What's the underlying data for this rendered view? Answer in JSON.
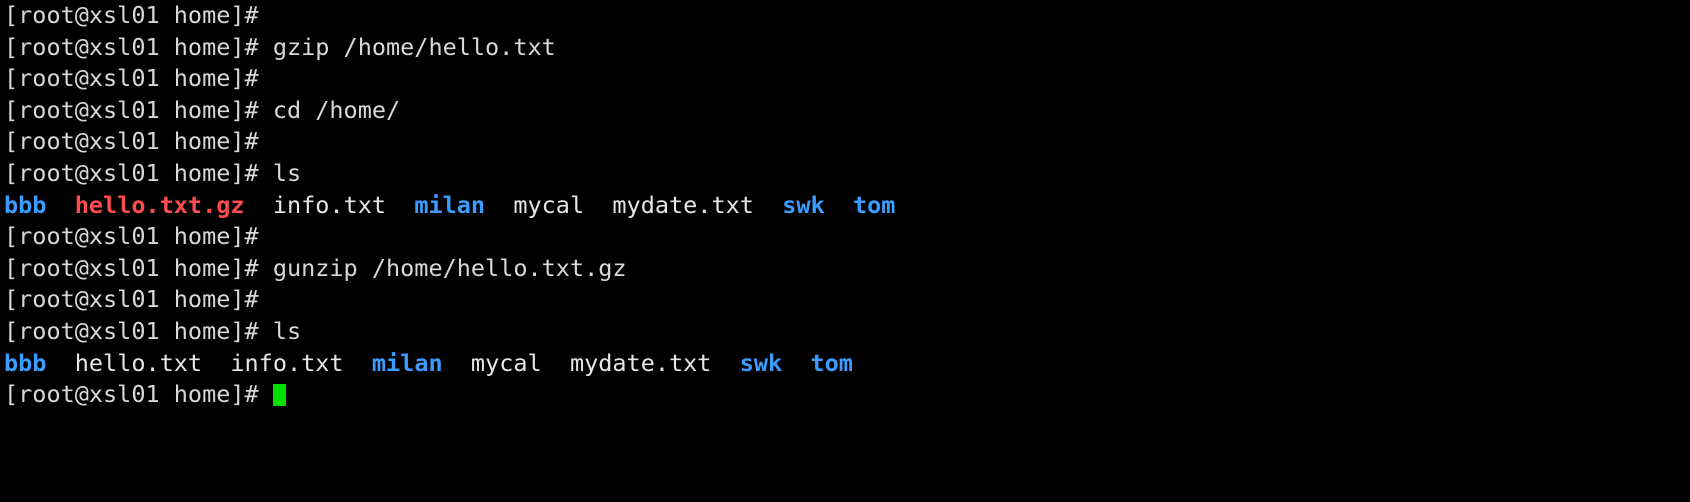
{
  "terminal": {
    "background_color": "#000000",
    "foreground_color": "#d8d8d8",
    "cursor_color": "#00e000",
    "prompt": "[root@xsl01 home]# ",
    "colors": {
      "directory": "#3b9dff",
      "archive": "#ff4d4d",
      "file": "#e6e6e6"
    },
    "lines": [
      {
        "index": 0,
        "type": "prompt",
        "segments": [
          {
            "text": "[root@xsl01 home]#",
            "color": "default"
          }
        ]
      },
      {
        "index": 1,
        "type": "command",
        "command": "gzip /home/hello.txt",
        "segments": [
          {
            "text": "[root@xsl01 home]# gzip /home/hello.txt",
            "color": "default"
          }
        ]
      },
      {
        "index": 2,
        "type": "prompt",
        "segments": [
          {
            "text": "[root@xsl01 home]#",
            "color": "default"
          }
        ]
      },
      {
        "index": 3,
        "type": "command",
        "command": "cd /home/",
        "segments": [
          {
            "text": "[root@xsl01 home]# cd /home/",
            "color": "default"
          }
        ]
      },
      {
        "index": 4,
        "type": "prompt",
        "segments": [
          {
            "text": "[root@xsl01 home]#",
            "color": "default"
          }
        ]
      },
      {
        "index": 5,
        "type": "command",
        "command": "ls",
        "segments": [
          {
            "text": "[root@xsl01 home]# ls",
            "color": "default"
          }
        ]
      },
      {
        "index": 6,
        "type": "output",
        "segments": [
          {
            "text": "bbb",
            "color": "blue"
          },
          {
            "text": "  ",
            "color": "default"
          },
          {
            "text": "hello.txt.gz",
            "color": "red"
          },
          {
            "text": "  ",
            "color": "default"
          },
          {
            "text": "info.txt",
            "color": "white"
          },
          {
            "text": "  ",
            "color": "default"
          },
          {
            "text": "milan",
            "color": "blue"
          },
          {
            "text": "  ",
            "color": "default"
          },
          {
            "text": "mycal",
            "color": "white"
          },
          {
            "text": "  ",
            "color": "default"
          },
          {
            "text": "mydate.txt",
            "color": "white"
          },
          {
            "text": "  ",
            "color": "default"
          },
          {
            "text": "swk",
            "color": "blue"
          },
          {
            "text": "  ",
            "color": "default"
          },
          {
            "text": "tom",
            "color": "blue"
          }
        ]
      },
      {
        "index": 7,
        "type": "prompt",
        "segments": [
          {
            "text": "[root@xsl01 home]#",
            "color": "default"
          }
        ]
      },
      {
        "index": 8,
        "type": "command",
        "command": "gunzip /home/hello.txt.gz",
        "segments": [
          {
            "text": "[root@xsl01 home]# gunzip /home/hello.txt.gz",
            "color": "default"
          }
        ]
      },
      {
        "index": 9,
        "type": "prompt",
        "segments": [
          {
            "text": "[root@xsl01 home]#",
            "color": "default"
          }
        ]
      },
      {
        "index": 10,
        "type": "command",
        "command": "ls",
        "segments": [
          {
            "text": "[root@xsl01 home]# ls",
            "color": "default"
          }
        ]
      },
      {
        "index": 11,
        "type": "output",
        "segments": [
          {
            "text": "bbb",
            "color": "blue"
          },
          {
            "text": "  ",
            "color": "default"
          },
          {
            "text": "hello.txt",
            "color": "white"
          },
          {
            "text": "  ",
            "color": "default"
          },
          {
            "text": "info.txt",
            "color": "white"
          },
          {
            "text": "  ",
            "color": "default"
          },
          {
            "text": "milan",
            "color": "blue"
          },
          {
            "text": "  ",
            "color": "default"
          },
          {
            "text": "mycal",
            "color": "white"
          },
          {
            "text": "  ",
            "color": "default"
          },
          {
            "text": "mydate.txt",
            "color": "white"
          },
          {
            "text": "  ",
            "color": "default"
          },
          {
            "text": "swk",
            "color": "blue"
          },
          {
            "text": "  ",
            "color": "default"
          },
          {
            "text": "tom",
            "color": "blue"
          }
        ]
      },
      {
        "index": 12,
        "type": "prompt-cursor",
        "segments": [
          {
            "text": "[root@xsl01 home]# ",
            "color": "default"
          }
        ],
        "cursor": true
      }
    ]
  }
}
